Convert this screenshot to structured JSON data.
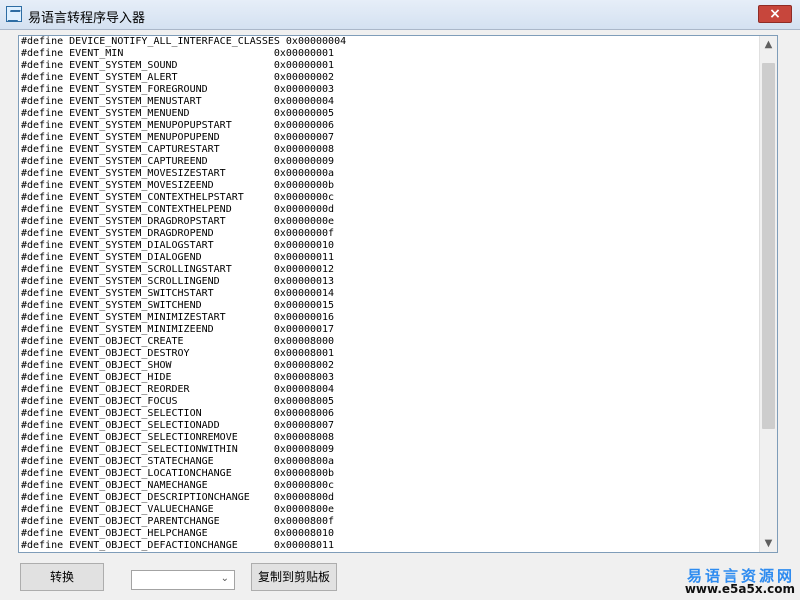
{
  "window": {
    "title": "易语言转程序导入器",
    "close_icon": "close-icon"
  },
  "editor": {
    "lines": [
      "#define DEVICE_NOTIFY_ALL_INTERFACE_CLASSES 0x00000004",
      "#define EVENT_MIN                         0x00000001",
      "#define EVENT_SYSTEM_SOUND                0x00000001",
      "#define EVENT_SYSTEM_ALERT                0x00000002",
      "#define EVENT_SYSTEM_FOREGROUND           0x00000003",
      "#define EVENT_SYSTEM_MENUSTART            0x00000004",
      "#define EVENT_SYSTEM_MENUEND              0x00000005",
      "#define EVENT_SYSTEM_MENUPOPUPSTART       0x00000006",
      "#define EVENT_SYSTEM_MENUPOPUPEND         0x00000007",
      "#define EVENT_SYSTEM_CAPTURESTART         0x00000008",
      "#define EVENT_SYSTEM_CAPTUREEND           0x00000009",
      "#define EVENT_SYSTEM_MOVESIZESTART        0x0000000a",
      "#define EVENT_SYSTEM_MOVESIZEEND          0x0000000b",
      "#define EVENT_SYSTEM_CONTEXTHELPSTART     0x0000000c",
      "#define EVENT_SYSTEM_CONTEXTHELPEND       0x0000000d",
      "#define EVENT_SYSTEM_DRAGDROPSTART        0x0000000e",
      "#define EVENT_SYSTEM_DRAGDROPEND          0x0000000f",
      "#define EVENT_SYSTEM_DIALOGSTART          0x00000010",
      "#define EVENT_SYSTEM_DIALOGEND            0x00000011",
      "#define EVENT_SYSTEM_SCROLLINGSTART       0x00000012",
      "#define EVENT_SYSTEM_SCROLLINGEND         0x00000013",
      "#define EVENT_SYSTEM_SWITCHSTART          0x00000014",
      "#define EVENT_SYSTEM_SWITCHEND            0x00000015",
      "#define EVENT_SYSTEM_MINIMIZESTART        0x00000016",
      "#define EVENT_SYSTEM_MINIMIZEEND          0x00000017",
      "#define EVENT_OBJECT_CREATE               0x00008000",
      "#define EVENT_OBJECT_DESTROY              0x00008001",
      "#define EVENT_OBJECT_SHOW                 0x00008002",
      "#define EVENT_OBJECT_HIDE                 0x00008003",
      "#define EVENT_OBJECT_REORDER              0x00008004",
      "#define EVENT_OBJECT_FOCUS                0x00008005",
      "#define EVENT_OBJECT_SELECTION            0x00008006",
      "#define EVENT_OBJECT_SELECTIONADD         0x00008007",
      "#define EVENT_OBJECT_SELECTIONREMOVE      0x00008008",
      "#define EVENT_OBJECT_SELECTIONWITHIN      0x00008009",
      "#define EVENT_OBJECT_STATECHANGE          0x0000800a",
      "#define EVENT_OBJECT_LOCATIONCHANGE       0x0000800b",
      "#define EVENT_OBJECT_NAMECHANGE           0x0000800c",
      "#define EVENT_OBJECT_DESCRIPTIONCHANGE    0x0000800d",
      "#define EVENT_OBJECT_VALUECHANGE          0x0000800e",
      "#define EVENT_OBJECT_PARENTCHANGE         0x0000800f",
      "#define EVENT_OBJECT_HELPCHANGE           0x00008010",
      "#define EVENT_OBJECT_DEFACTIONCHANGE      0x00008011"
    ],
    "scroll_position": 0.02,
    "scroll_visible_fraction": 0.76
  },
  "controls": {
    "convert_label": "转换",
    "select_value": "",
    "copy_label": "复制到剪贴板"
  },
  "watermark": {
    "cn": "易语言资源网",
    "en": "www.e5a5x.com"
  },
  "colors": {
    "accent": "#2f8cf0",
    "close": "#c7463c"
  }
}
